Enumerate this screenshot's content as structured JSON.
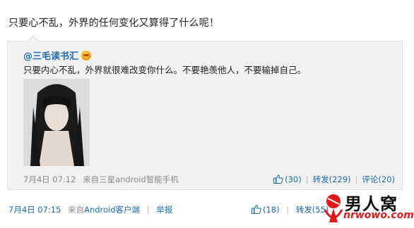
{
  "post": {
    "text": "只要心不乱，外界的任何变化又算得了什么呢！"
  },
  "quote": {
    "author": "@三毛读书汇",
    "text": "只要内心不乱，外界就很难改变你什么。不要艳羡他人，不要输掉自己。",
    "footer": {
      "time": "7月4日 07:12",
      "source_prefix": "来自",
      "source": "三星android智能手机",
      "like_count": "(30)",
      "repost_label": "转发(229)",
      "comment_label": "评论(20)"
    }
  },
  "footer": {
    "time": "7月4日 07:15",
    "source_prefix": "来自",
    "source": "Android客户端",
    "report_label": "举报",
    "like_count": "(18)",
    "repost_label": "转发(55)"
  },
  "watermark": {
    "brand": "男人窝",
    "url": "nrwowo.com"
  },
  "colors": {
    "link": "#1a6bb5",
    "quote_bg": "#f2f2f2",
    "watermark_red": "#e01a1a"
  }
}
